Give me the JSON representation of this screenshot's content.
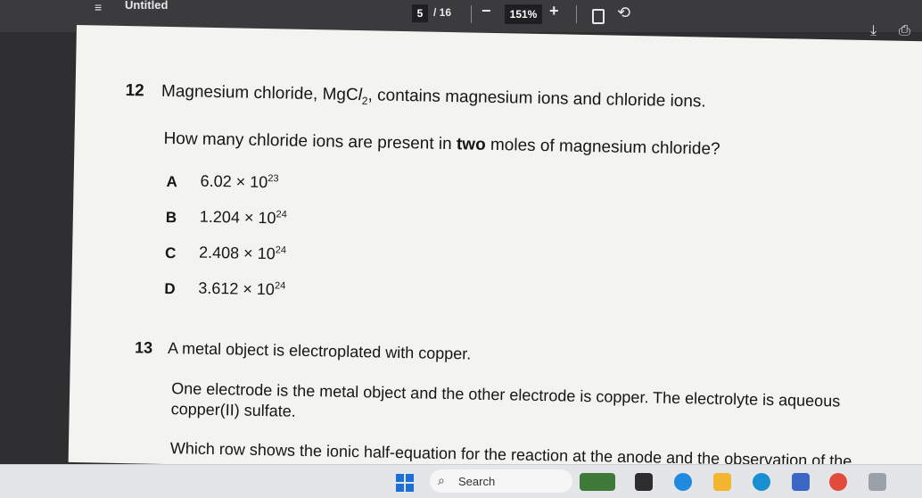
{
  "toolbar": {
    "menu_glyph": "≡",
    "title": "Untitled",
    "current_page": "5",
    "page_total": "/ 16",
    "zoom_out": "−",
    "zoom": "151%",
    "zoom_in": "+",
    "icons": [
      "menu-icon",
      "fit-page-icon",
      "rotate-icon",
      "download-icon",
      "print-icon"
    ]
  },
  "q12": {
    "number": "12",
    "stem_pre": "Magnesium chloride, MgC",
    "stem_l": "l",
    "stem_sub": "2",
    "stem_post": ", contains magnesium ions and chloride ions.",
    "question_pre": "How many chloride ions are present in ",
    "question_bold": "two",
    "question_post": " moles of magnesium chloride?",
    "options": [
      {
        "letter": "A",
        "mantissa": "6.02 × 10",
        "exp": "23"
      },
      {
        "letter": "B",
        "mantissa": "1.204 × 10",
        "exp": "24"
      },
      {
        "letter": "C",
        "mantissa": "2.408 × 10",
        "exp": "24"
      },
      {
        "letter": "D",
        "mantissa": "3.612 × 10",
        "exp": "24"
      }
    ]
  },
  "q13": {
    "number": "13",
    "stem": "A metal object is electroplated with copper.",
    "para1_line1": "One electrode is the metal object and the other electrode is copper. The electrolyte is aqueous",
    "para1_line2": "copper(II) sulfate.",
    "para2": "Which row shows the ionic half-equation for the reaction at the anode and the observation of the"
  },
  "taskbar": {
    "search_label": "Search",
    "icons": [
      "windows-start-icon",
      "search-icon",
      "widgets-icon",
      "terminal-icon",
      "copilot-icon",
      "file-explorer-icon",
      "edge-icon",
      "store-icon",
      "chrome-icon",
      "app-icon"
    ],
    "colors": {
      "windows_blue": "#1b6fd6"
    }
  }
}
